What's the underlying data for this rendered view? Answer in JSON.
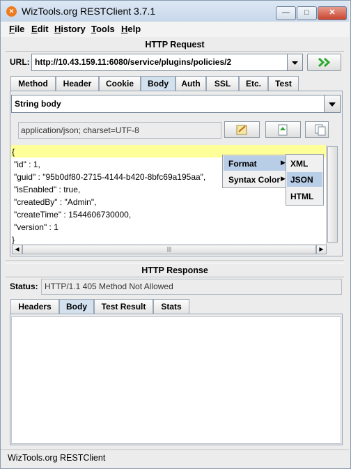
{
  "window": {
    "title": "WizTools.org RESTClient 3.7.1",
    "app_icon_glyph": "✕"
  },
  "menu": [
    {
      "first": "F",
      "rest": "ile"
    },
    {
      "first": "E",
      "rest": "dit"
    },
    {
      "first": "H",
      "rest": "istory"
    },
    {
      "first": "T",
      "rest": "ools"
    },
    {
      "first": "H",
      "rest": "elp"
    }
  ],
  "request": {
    "title": "HTTP Request",
    "url_label": "URL:",
    "url_value": "http://10.43.159.11:6080/service/plugins/policies/2",
    "go_glyph": "»",
    "tabs": [
      "Method",
      "Header",
      "Cookie",
      "Body",
      "Auth",
      "SSL",
      "Etc.",
      "Test"
    ],
    "active_tab": "Body",
    "body_type": "String body",
    "content_type": "application/json; charset=UTF-8",
    "body_lines": [
      "{",
      "\"id\" : 1,",
      "\"guid\" : \"95b0df80-2715-4144-b420-8bfc69a195aa\",",
      "\"isEnabled\" : true,",
      "\"createdBy\" : \"Admin\",",
      "\"createTime\" : 1544606730000,",
      "\"version\" : 1",
      "}"
    ]
  },
  "context_menu": {
    "items": [
      "Format",
      "Syntax Color"
    ],
    "submenu": [
      "XML",
      "JSON",
      "HTML"
    ],
    "highlighted": "JSON"
  },
  "response": {
    "title": "HTTP Response",
    "status_label": "Status:",
    "status_value": "HTTP/1.1 405 Method Not Allowed",
    "tabs": [
      "Headers",
      "Body",
      "Test Result",
      "Stats"
    ],
    "active_tab": "Body"
  },
  "statusbar": {
    "text": "WizTools.org RESTClient"
  },
  "colors": {
    "tab_active": "#d3e1ef",
    "editor_highlight": "#ffff99",
    "go_arrow": "#2eaa2e",
    "menu_highlight": "#b8cde6"
  }
}
